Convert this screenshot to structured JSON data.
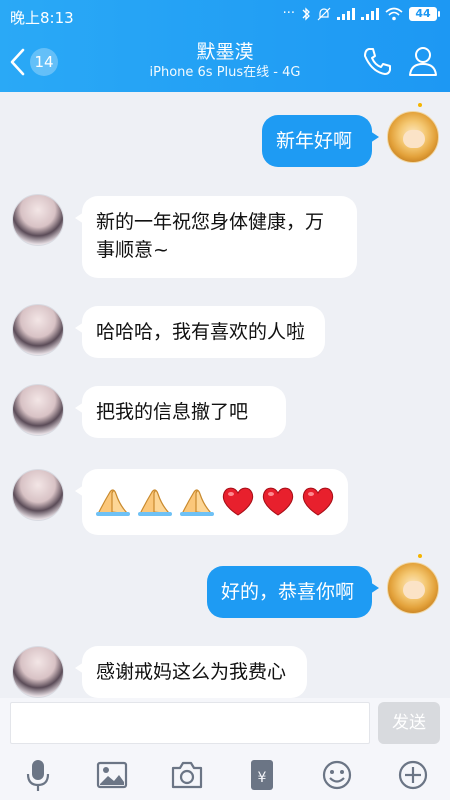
{
  "status_bar": {
    "time": "晚上8:13",
    "battery": "44"
  },
  "header": {
    "back_count": "14",
    "title": "默墨漠",
    "subtitle": "iPhone 6s Plus在线 - 4G"
  },
  "messages": [
    {
      "side": "self",
      "text": "新年好啊"
    },
    {
      "side": "other",
      "text_line1": "新的一年祝您身体健康，万",
      "text_line2": "事顺意~"
    },
    {
      "side": "other",
      "text": "哈哈哈，我有喜欢的人啦"
    },
    {
      "side": "other",
      "text": "把我的信息撤了吧"
    },
    {
      "side": "other",
      "emojis": [
        "folded-hands",
        "folded-hands",
        "folded-hands",
        "heart",
        "heart",
        "heart"
      ]
    },
    {
      "side": "self",
      "text": "好的，恭喜你啊"
    },
    {
      "side": "other",
      "text": "感谢戒妈这么为我费心"
    }
  ],
  "input": {
    "placeholder": "",
    "send_label": "发送"
  },
  "toolbar": [
    "microphone-icon",
    "image-icon",
    "camera-icon",
    "red-packet-icon",
    "emoji-icon",
    "plus-icon"
  ],
  "colors": {
    "header": "#1d98f3",
    "self_bubble": "#1e9bf3",
    "other_bubble": "#ffffff",
    "background": "#eef0f5"
  }
}
